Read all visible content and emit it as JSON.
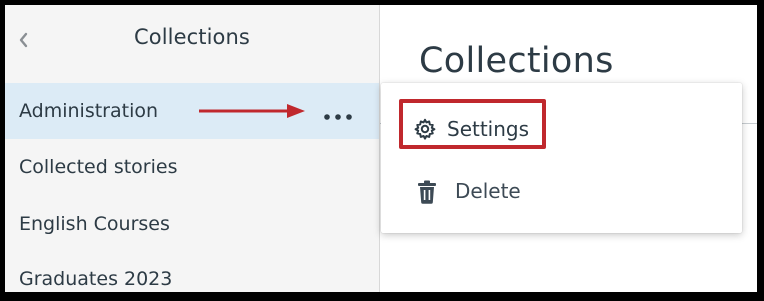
{
  "sidebar": {
    "title": "Collections",
    "items": [
      {
        "label": "Administration"
      },
      {
        "label": "Collected stories"
      },
      {
        "label": "English Courses"
      },
      {
        "label": "Graduates 2023"
      }
    ]
  },
  "main": {
    "title": "Collections"
  },
  "menu": {
    "items": [
      {
        "label": "Settings",
        "icon": "gear-icon"
      },
      {
        "label": "Delete",
        "icon": "trash-icon"
      }
    ]
  },
  "colors": {
    "active_row": "#dcebf6",
    "annotation_red": "#c0282d",
    "text": "#2d3b45"
  }
}
